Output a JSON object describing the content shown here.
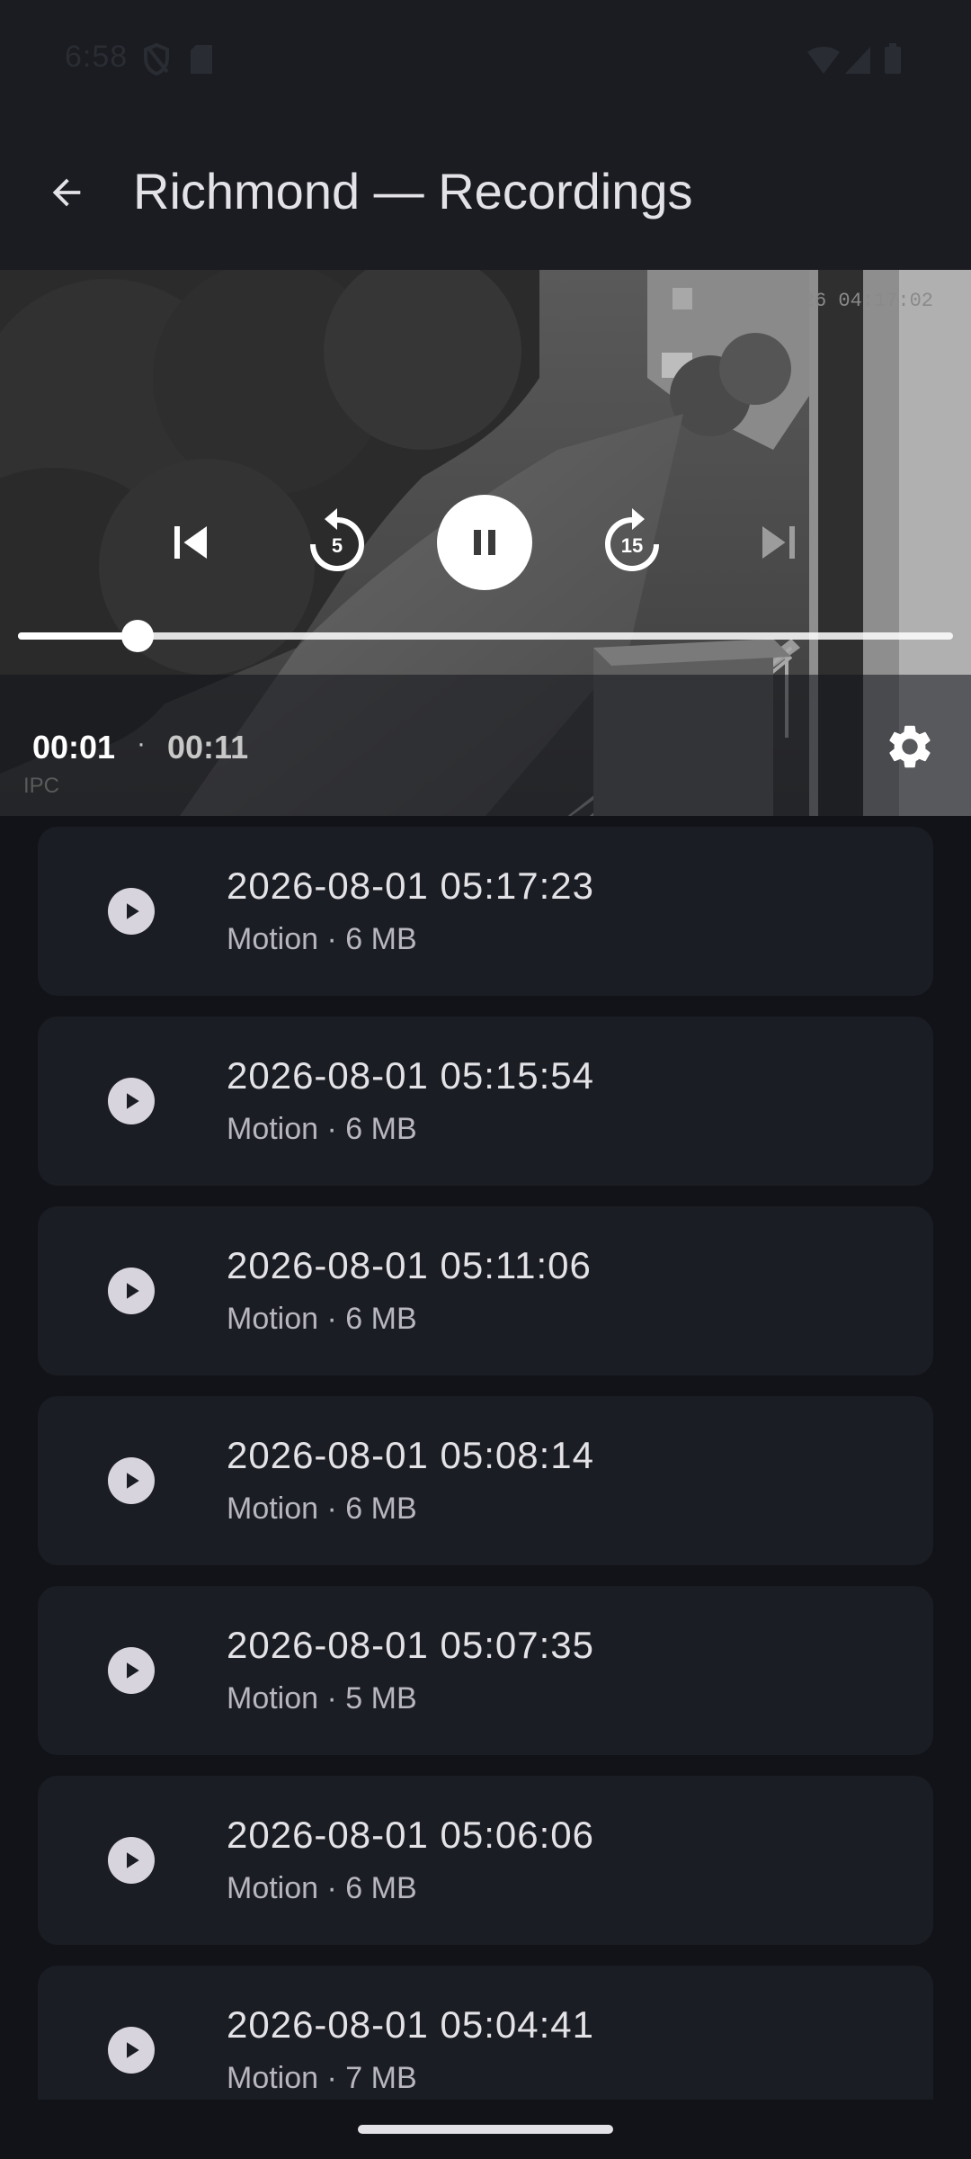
{
  "status_bar": {
    "time": "6:58",
    "icons_left": [
      "shield-icon",
      "sim-card-icon"
    ],
    "icons_right": [
      "wifi-icon",
      "signal-icon",
      "battery-icon"
    ]
  },
  "app_bar": {
    "title": "Richmond — Recordings",
    "back_icon": "arrow-back-icon"
  },
  "player": {
    "overlay_timestamp": "01-08-2026 04:17:02",
    "state": "playing",
    "controls": {
      "previous_icon": "skip-previous-icon",
      "rewind_icon": "replay-5-icon",
      "rewind_seconds": "5",
      "pause_icon": "pause-icon",
      "forward_icon": "forward-15-icon",
      "forward_seconds": "15",
      "next_icon": "skip-next-icon"
    },
    "progress_fraction": 0.128,
    "time_current": "00:01",
    "time_separator": "·",
    "time_total": "00:11",
    "source_label": "IPC",
    "settings_icon": "gear-icon"
  },
  "recordings": [
    {
      "title": "2026-08-01 05:17:23",
      "subtitle": "Motion · 6 MB"
    },
    {
      "title": "2026-08-01 05:15:54",
      "subtitle": "Motion · 6 MB"
    },
    {
      "title": "2026-08-01 05:11:06",
      "subtitle": "Motion · 6 MB"
    },
    {
      "title": "2026-08-01 05:08:14",
      "subtitle": "Motion · 6 MB"
    },
    {
      "title": "2026-08-01 05:07:35",
      "subtitle": "Motion · 5 MB"
    },
    {
      "title": "2026-08-01 05:06:06",
      "subtitle": "Motion · 6 MB"
    },
    {
      "title": "2026-08-01 05:04:41",
      "subtitle": "Motion · 7 MB"
    }
  ],
  "colors": {
    "background": "#111318",
    "surface": "#1b1d24",
    "app_bar": "#1a1c22",
    "on_surface": "#e3e2e6",
    "secondary_text": "#b8b6be"
  }
}
